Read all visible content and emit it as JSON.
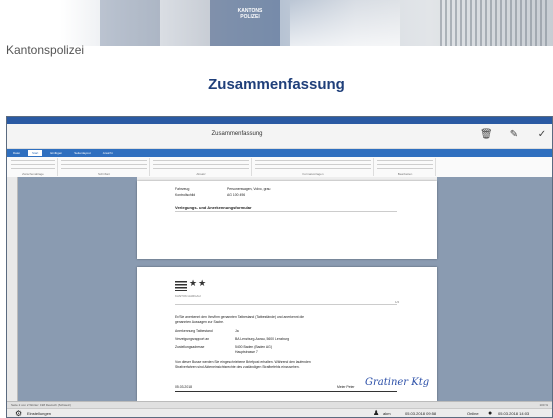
{
  "slide": {
    "org_label": "Kantonspolizei",
    "title": "Zusammenfassung",
    "banner_sign": "KANTONS POLIZEI"
  },
  "app": {
    "os_title": "Dokument",
    "doc_title": "Zusammenfassung",
    "ribbon_tabs": [
      "Datei",
      "Start",
      "Einfügen",
      "Seitenlayout",
      "Ansicht"
    ],
    "ribbon_groups": [
      "Zwischenablage",
      "Schriftart",
      "Absatz",
      "Formatvorlagen",
      "Bearbeiten"
    ],
    "colors": {
      "accent": "#2f6fbf",
      "workspace": "#8a9bb1",
      "title": "#1f3f7a"
    }
  },
  "document": {
    "page1": {
      "rows": [
        {
          "label": "Fahrzeug",
          "value": "Personenwagen, Volvo, grau"
        },
        {
          "label": "Kontrollschild",
          "value": "AG 100 496"
        }
      ],
      "section": "Verlegungs- und Anerkennungsformular"
    },
    "page2": {
      "org": "KANTON AARGAU",
      "stars": "★★",
      "page_no": "1/2",
      "intro": "Er/Sie anerkennt den Ihm/ihm genannten Tatbestand (Tatbestände) und anerkennt die",
      "intro2": "genannten Aussagen zur Sache.",
      "rows": [
        {
          "label": "Anerkennung Tatbestand",
          "value": "Ja"
        },
        {
          "label": "Verzeigungsrapport an",
          "value": "BA Lenzburg-Aarau, 5600 Lenzburg"
        },
        {
          "label": "Zustellungsadresse",
          "value": "5400 Baden (Baden AG)"
        },
        {
          "label": "",
          "value": "Hauptstrasse 7"
        }
      ],
      "note1": "Von dieser Busse werden Sie eingeschriebene Briefpost erhalten. Während den laufenden",
      "note2": "Strafverfahren sind Akteneinsichtsrechte des zuständigen Strafbefehls einzusehen.",
      "date": "05.03.2018",
      "signer": "Meier Peter",
      "signature": "Gratiner Ktg"
    }
  },
  "statusbar": {
    "left": "Seite 2 von 2   Wörter: 198   Deutsch (Schweiz)",
    "right": "100 %"
  },
  "taskbar": {
    "app_button": "Einstellungen",
    "user": "akm",
    "datetime1": "05.03.2018 09:58",
    "status": "Online",
    "datetime2": "05.03.2018 14:03"
  }
}
